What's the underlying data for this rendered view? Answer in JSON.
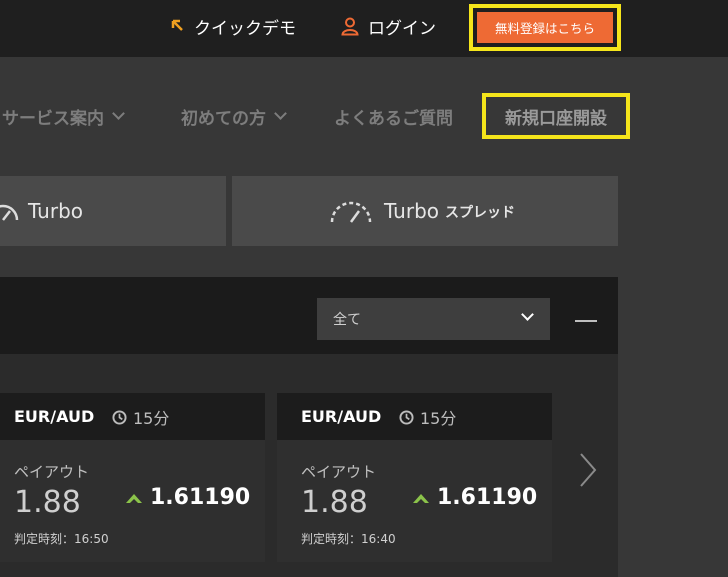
{
  "header": {
    "quick_demo": "クイックデモ",
    "login": "ログイン",
    "register": "無料登録はこちら"
  },
  "nav": {
    "services": "サービス案内",
    "first_time": "初めての方",
    "faq": "よくあるご質問",
    "open_account": "新規口座開設"
  },
  "tabs": {
    "turbo": "Turbo",
    "turbo_spread": "Turbo",
    "turbo_spread_suffix": "スプレッド"
  },
  "filter": {
    "selected": "全て"
  },
  "cards": [
    {
      "pair": "EUR/AUD",
      "duration": "15分",
      "payout_label": "ペイアウト",
      "payout": "1.88",
      "price": "1.61190",
      "judge": "判定時刻：16:50"
    },
    {
      "pair": "EUR/AUD",
      "duration": "15分",
      "payout_label": "ペイアウト",
      "payout": "1.88",
      "price": "1.61190",
      "judge": "判定時刻：16:40"
    }
  ],
  "colors": {
    "accent": "#ee6a34",
    "highlight": "#f5e51b",
    "up": "#8bc34a"
  }
}
